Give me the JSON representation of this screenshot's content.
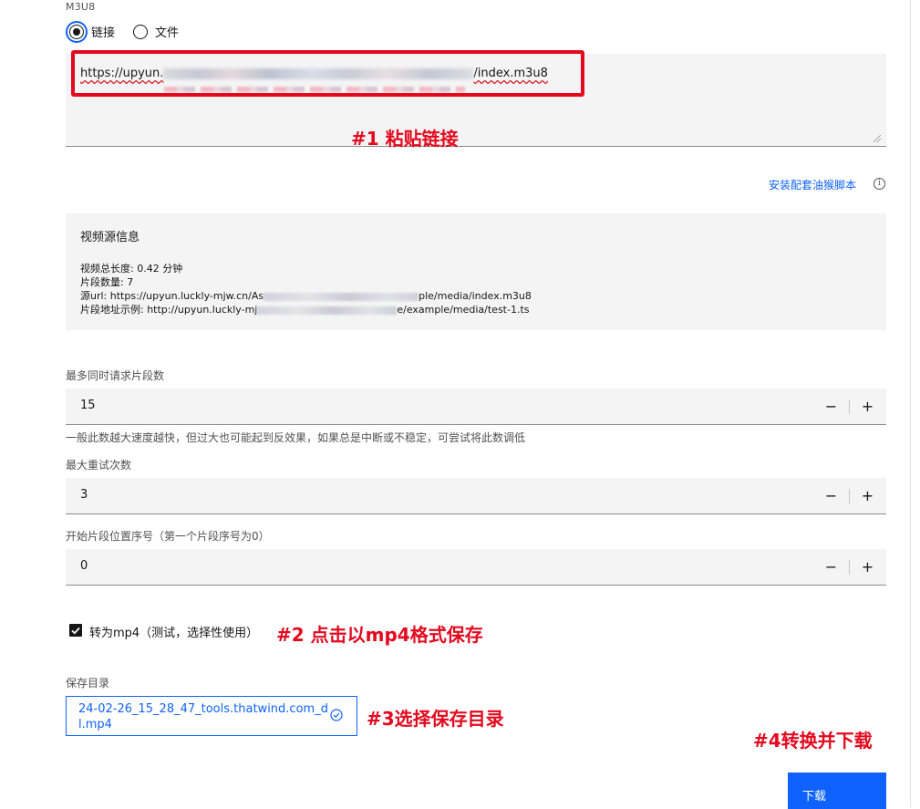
{
  "m3u8": {
    "section_label": "M3U8",
    "radio_link": "链接",
    "radio_file": "文件",
    "url_prefix": "https://upyun.",
    "url_suffix": "/index.m3u8"
  },
  "annotations": {
    "step1": "#1 粘贴链接",
    "step2": "#2 点击以mp4格式保存",
    "step3": "#3选择保存目录",
    "step4": "#4转换并下载"
  },
  "script_link": {
    "label": "安装配套油猴脚本",
    "icon": "info-icon"
  },
  "source_info": {
    "title": "视频源信息",
    "duration": "视频总长度: 0.42 分钟",
    "segments": "片段数量: 7",
    "src_prefix": "源url: https://upyun.luckly-mjw.cn/As",
    "src_suffix": "ple/media/index.m3u8",
    "seg_prefix": "片段地址示例: http://upyun.luckly-mj",
    "seg_suffix": "e/example/media/test-1.ts"
  },
  "concurrency": {
    "label": "最多同时请求片段数",
    "value": "15",
    "helper": "一般此数越大速度越快，但过大也可能起到反效果，如果总是中断或不稳定，可尝试将此数调低"
  },
  "retries": {
    "label": "最大重试次数",
    "value": "3"
  },
  "start_index": {
    "label": "开始片段位置序号（第一个片段序号为0）",
    "value": "0"
  },
  "stepper": {
    "minus": "−",
    "plus": "+"
  },
  "mp4": {
    "label": "转为mp4（测试，选择性使用）",
    "checked": true
  },
  "save_dir": {
    "label": "保存目录",
    "value": "24-02-26_15_28_47_tools.thatwind.com_dl.mp4"
  },
  "download": {
    "label": "下载"
  },
  "colors": {
    "accent": "#0f62fe",
    "annotation": "#e4091e"
  }
}
